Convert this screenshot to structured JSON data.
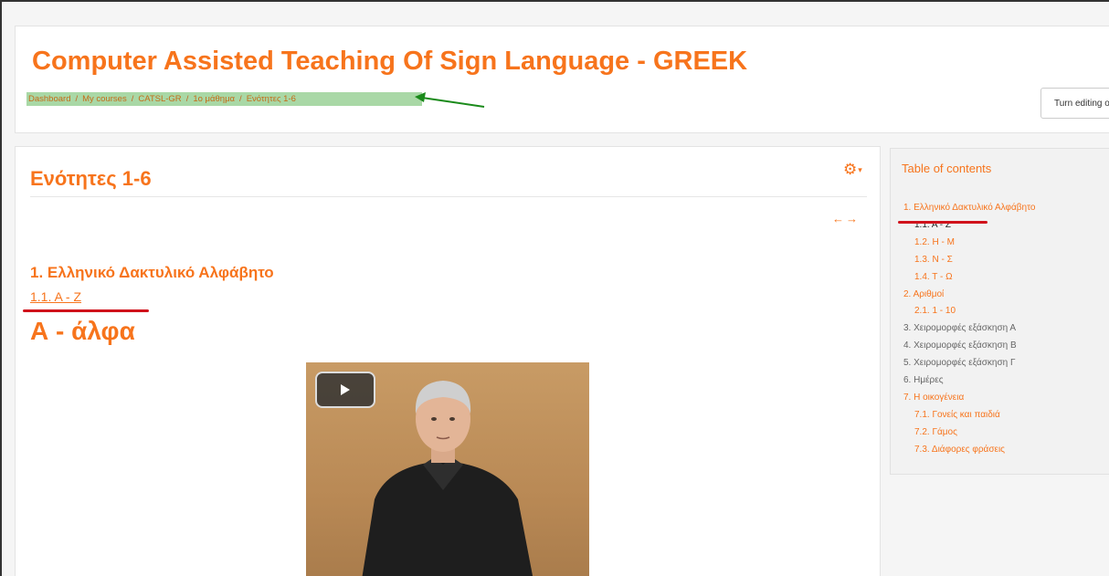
{
  "header": {
    "course_title": "Computer Assisted Teaching Of Sign Language - GREEK",
    "breadcrumb": [
      "Dashboard",
      "My courses",
      "CATSL-GR",
      "1ο μάθημα",
      "Ενότητες 1-6"
    ],
    "edit_button": "Turn editing o"
  },
  "main": {
    "section_title": "Ενότητες 1-6",
    "chapter_title": "1. Ελληνικό Δακτυλικό Αλφάβητο",
    "subchapter": "1.1. Α - Ζ",
    "letter_title": "Α - άλφα"
  },
  "toc": {
    "heading": "Table of contents",
    "items": [
      {
        "label": "1. Ελληνικό Δακτυλικό Αλφάβητο",
        "level": 1,
        "style": "link"
      },
      {
        "label": "1.1. Α - Ζ",
        "level": 2,
        "style": "current"
      },
      {
        "label": "1.2. Η - Μ",
        "level": 2,
        "style": "link"
      },
      {
        "label": "1.3. Ν - Σ",
        "level": 2,
        "style": "link"
      },
      {
        "label": "1.4. Τ - Ω",
        "level": 2,
        "style": "link"
      },
      {
        "label": "2. Αριθμοί",
        "level": 1,
        "style": "link"
      },
      {
        "label": "2.1. 1 - 10",
        "level": 2,
        "style": "link"
      },
      {
        "label": "3. Χειρομορφές εξάσκηση Α",
        "level": 1,
        "style": "plain"
      },
      {
        "label": "4. Χειρομορφές εξάσκηση Β",
        "level": 1,
        "style": "plain"
      },
      {
        "label": "5. Χειρομορφές εξάσκηση Γ",
        "level": 1,
        "style": "plain"
      },
      {
        "label": "6. Ημέρες",
        "level": 1,
        "style": "plain"
      },
      {
        "label": "7. Η οικογένεια",
        "level": 1,
        "style": "link"
      },
      {
        "label": "7.1. Γονείς και παιδιά",
        "level": 2,
        "style": "link"
      },
      {
        "label": "7.2. Γάμος",
        "level": 2,
        "style": "link"
      },
      {
        "label": "7.3. Διάφορες φράσεις",
        "level": 2,
        "style": "link"
      }
    ]
  },
  "icons": {
    "gear": "gear-icon",
    "prev": "arrow-left-icon",
    "next": "arrow-right-icon",
    "play": "play-icon"
  },
  "colors": {
    "accent": "#f7741c",
    "breadcrumb_highlight": "#a9d8a6",
    "annotation_red": "#d0121b",
    "annotation_green": "#1a8a1a"
  }
}
